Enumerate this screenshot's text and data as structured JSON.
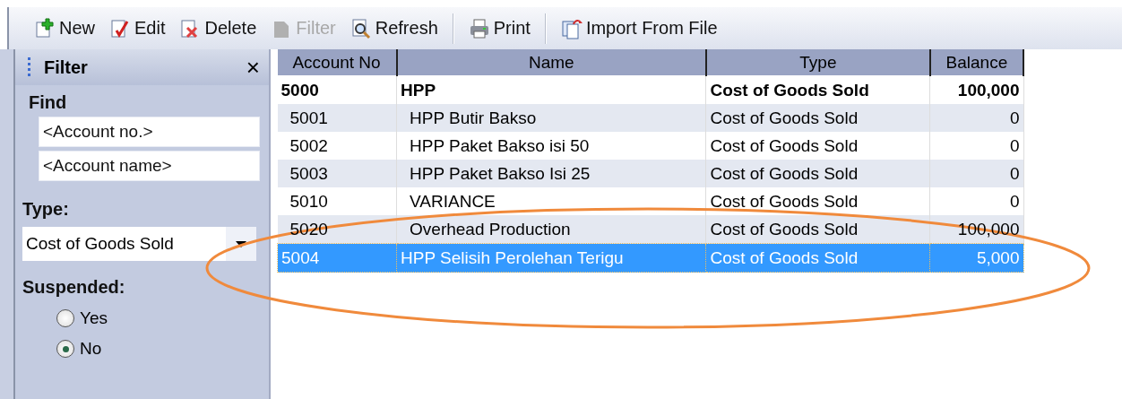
{
  "toolbar": [
    {
      "kind": "button",
      "label": "New",
      "disabled": false
    },
    {
      "kind": "button",
      "label": "Edit",
      "disabled": false
    },
    {
      "kind": "button",
      "label": "Delete",
      "disabled": false
    },
    {
      "kind": "button",
      "label": "Filter",
      "disabled": true
    },
    {
      "kind": "button",
      "label": "Refresh",
      "disabled": false
    },
    {
      "kind": "separator"
    },
    {
      "kind": "button",
      "label": "Print",
      "disabled": false
    },
    {
      "kind": "separator"
    },
    {
      "kind": "button",
      "label": "Import From File",
      "disabled": false
    }
  ],
  "filter_panel": {
    "title": "Filter",
    "close": "×",
    "find_label": "Find",
    "fields": [
      {
        "placeholder": "<Account no.>"
      },
      {
        "placeholder": "<Account name>"
      }
    ],
    "type_label": "Type:",
    "type_value": "Cost of Goods Sold",
    "suspended_label": "Suspended:",
    "options": [
      {
        "label": "Yes",
        "selected": false
      },
      {
        "label": "No",
        "selected": true
      }
    ]
  },
  "table": {
    "columns": [
      "Account No",
      "Name",
      "Type",
      "Balance"
    ],
    "rows": [
      {
        "cells": [
          "5000",
          "HPP",
          "Cost of Goods Sold",
          "100,000"
        ],
        "selected": false,
        "children": [
          {
            "cells": [
              "5001",
              "HPP Butir Bakso",
              "Cost of Goods Sold",
              "0"
            ],
            "selected": false
          },
          {
            "cells": [
              "5002",
              "HPP Paket Bakso isi 50",
              "Cost of Goods Sold",
              "0"
            ],
            "selected": false
          },
          {
            "cells": [
              "5003",
              "HPP Paket Bakso Isi 25",
              "Cost of Goods Sold",
              "0"
            ],
            "selected": false
          },
          {
            "cells": [
              "5010",
              "VARIANCE",
              "Cost of Goods Sold",
              "0"
            ],
            "selected": false
          },
          {
            "cells": [
              "5020",
              "Overhead Production",
              "Cost of Goods Sold",
              "100,000"
            ],
            "selected": false
          }
        ]
      },
      {
        "cells": [
          "5004",
          "HPP Selisih Perolehan Terigu",
          "Cost of Goods Sold",
          "5,000"
        ],
        "selected": true
      }
    ]
  }
}
